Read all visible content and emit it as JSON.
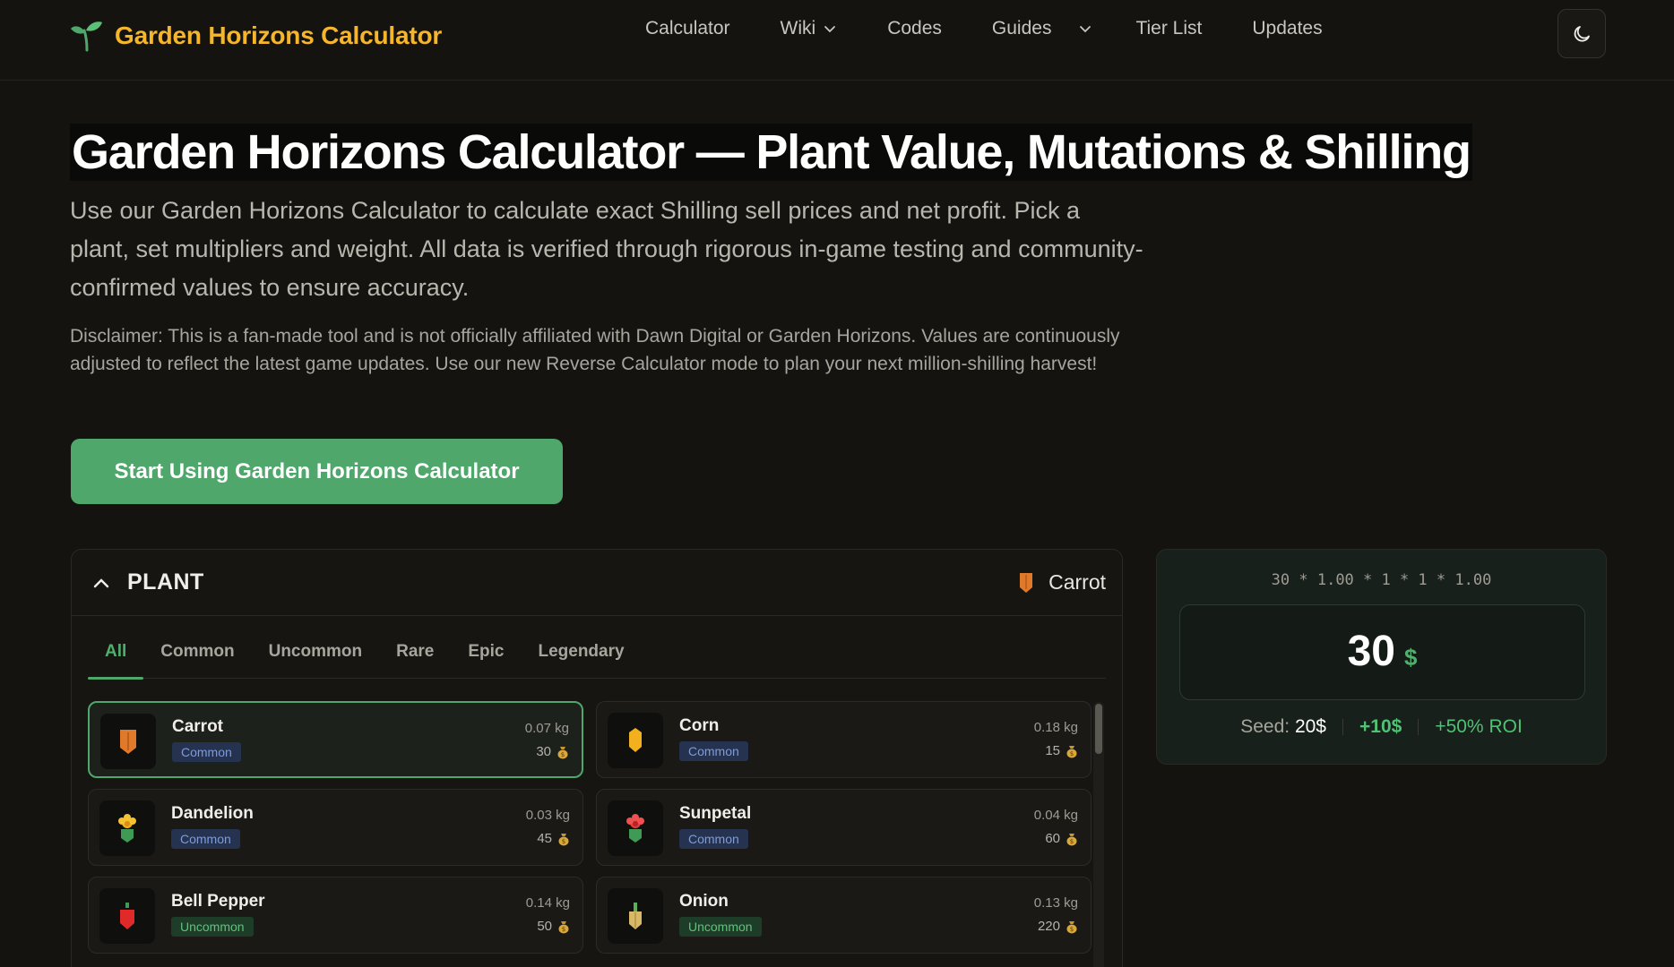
{
  "header": {
    "logo_text": "Garden Horizons Calculator",
    "nav": [
      {
        "label": "Calculator",
        "has_dropdown": false
      },
      {
        "label": "Wiki",
        "has_dropdown": true
      },
      {
        "label": "Codes",
        "has_dropdown": false
      },
      {
        "label": "Guides",
        "has_dropdown": true
      },
      {
        "label": "Tier List",
        "has_dropdown": false
      },
      {
        "label": "Updates",
        "has_dropdown": false
      }
    ],
    "theme_icon": "moon-icon"
  },
  "hero": {
    "title": "Garden Horizons Calculator — Plant Value, Mutations & Shilling",
    "description": "Use our Garden Horizons Calculator to calculate exact Shilling sell prices and net profit. Pick a plant, set multipliers and weight. All data is verified through rigorous in-game testing and community-confirmed values to ensure accuracy.",
    "disclaimer": "Disclaimer: This is a fan-made tool and is not officially affiliated with Dawn Digital or Garden Horizons. Values are continuously adjusted to reflect the latest game updates. Use our new Reverse Calculator mode to plan your next million-shilling harvest!",
    "cta_label": "Start Using Garden Horizons Calculator"
  },
  "plant_panel": {
    "title": "PLANT",
    "selected_plant": "Carrot",
    "tabs": [
      "All",
      "Common",
      "Uncommon",
      "Rare",
      "Epic",
      "Legendary"
    ],
    "active_tab": "All",
    "plants": [
      {
        "name": "Carrot",
        "rarity": "Common",
        "weight": "0.07 kg",
        "price": "30",
        "icon": "carrot-icon",
        "selected": true
      },
      {
        "name": "Corn",
        "rarity": "Common",
        "weight": "0.18 kg",
        "price": "15",
        "icon": "corn-icon",
        "selected": false
      },
      {
        "name": "Dandelion",
        "rarity": "Common",
        "weight": "0.03 kg",
        "price": "45",
        "icon": "dandelion-icon",
        "selected": false
      },
      {
        "name": "Sunpetal",
        "rarity": "Common",
        "weight": "0.04 kg",
        "price": "60",
        "icon": "sunpetal-icon",
        "selected": false
      },
      {
        "name": "Bell Pepper",
        "rarity": "Uncommon",
        "weight": "0.14 kg",
        "price": "50",
        "icon": "bell-pepper-icon",
        "selected": false
      },
      {
        "name": "Onion",
        "rarity": "Uncommon",
        "weight": "0.13 kg",
        "price": "220",
        "icon": "onion-icon",
        "selected": false
      }
    ]
  },
  "result": {
    "formula": "30 * 1.00 * 1 * 1 * 1.00",
    "value": "30",
    "currency": "$",
    "seed_label": "Seed:",
    "seed_value": "20$",
    "profit": "+10$",
    "roi": "+50% ROI"
  },
  "colors": {
    "accent_green": "#4fa76b",
    "logo_yellow": "#f5b62b",
    "background": "#141310"
  }
}
